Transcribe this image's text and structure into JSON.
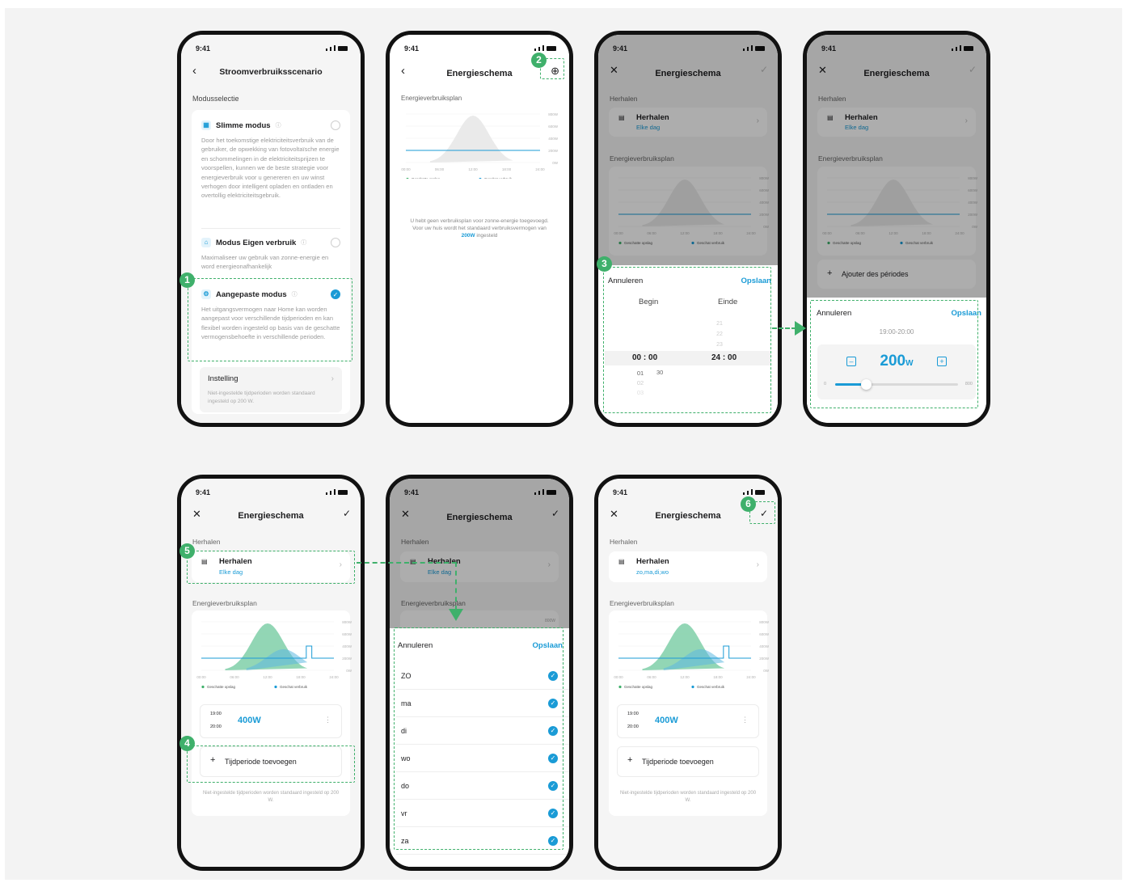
{
  "status_time": "9:41",
  "colors": {
    "accent": "#1a9bd6",
    "green": "#3fb06b",
    "chart_area": "#7fcfa8"
  },
  "chart": {
    "y_ticks": [
      "800W",
      "600W",
      "400W",
      "200W",
      "0W"
    ],
    "x_ticks": [
      "00:00",
      "06:00",
      "12:00",
      "18:00",
      "24:00"
    ],
    "legend_storage": "Geschatte opslag",
    "legend_consumption": "Geschat verbruik"
  },
  "s1": {
    "title": "Stroomverbruiksscenario",
    "section": "Modusselectie",
    "modes": [
      {
        "label": "Slimme modus",
        "icon": "smart-mode-icon",
        "desc": "Door het toekomstige elektriciteitsverbruik van de gebruiker, de opwekking van fotovoltaïsche energie en schommelingen in de elektriciteitsprijzen te voorspellen, kunnen we de beste strategie voor energieverbruik voor u genereren en uw winst verhogen door intelligent opladen en ontladen en overtollig elektriciteitsgebruik."
      },
      {
        "label": "Modus Eigen verbruik",
        "icon": "home-icon",
        "desc": "Maximaliseer uw gebruik van zonne-energie en word energieonafhankelijk"
      },
      {
        "label": "Aangepaste modus",
        "icon": "gear-icon",
        "desc": "Het uitgangsvermogen naar Home kan worden aangepast voor verschillende tijdperioden en kan flexibel worden ingesteld op basis van de geschatte vermogensbehoefte in verschillende perioden."
      }
    ],
    "setting_label": "Instelling",
    "setting_desc": "Niet-ingestelde tijdperioden worden standaard ingesteld op 200 W."
  },
  "s2": {
    "title": "Energieschema",
    "section": "Energieverbruiksplan",
    "empty_text": "U hebt geen verbruiksplan voor zonne-energie toegevoegd. Voor uw huis wordt het standaard verbruiksvermogen van",
    "empty_value": "200W",
    "empty_tail": "ingesteld"
  },
  "s3": {
    "title": "Energieschema",
    "repeat_section": "Herhalen",
    "repeat_label": "Herhalen",
    "repeat_value": "Elke dag",
    "plan_section": "Energieverbruiksplan",
    "cancel": "Annuleren",
    "save": "Opslaan",
    "begin": "Begin",
    "end": "Einde",
    "end_above": [
      "21",
      "22",
      "23"
    ],
    "sel_begin_h": "00",
    "sel_begin_m": "00",
    "sel_end_h": "24",
    "sel_end_m": "00",
    "below_h": [
      "01",
      "02",
      "03"
    ],
    "below_m": "30"
  },
  "s4": {
    "title": "Energieschema",
    "add_periods": "Ajouter des périodes",
    "cancel": "Annuleren",
    "save": "Opslaan",
    "range": "19:00-20:00",
    "value": "200",
    "unit": "W",
    "min": "0",
    "max": "800",
    "minus": "–",
    "plus": "+",
    "slider_fraction": 0.25
  },
  "s5": {
    "title": "Energieschema",
    "repeat_section": "Herhalen",
    "repeat_label": "Herhalen",
    "repeat_value": "Elke dag",
    "plan_section": "Energieverbruiksplan",
    "period_start": "19:00",
    "period_end": "20:00",
    "period_value": "400W",
    "add_period": "Tijdperiode toevoegen",
    "footer": "Niet-ingestelde tijdperioden worden standaard ingesteld op 200 W."
  },
  "s6": {
    "title": "Energieschema",
    "repeat_section": "Herhalen",
    "repeat_label": "Herhalen",
    "repeat_value": "Elke dag",
    "plan_section": "Energieverbruiksplan",
    "tick": "800W",
    "cancel": "Annuleren",
    "save": "Opslaan",
    "days": [
      "ZO",
      "ma",
      "di",
      "wo",
      "do",
      "vr",
      "za"
    ]
  },
  "s7": {
    "title": "Energieschema",
    "repeat_section": "Herhalen",
    "repeat_label": "Herhalen",
    "repeat_value": "zo,ma,di,wo",
    "plan_section": "Energieverbruiksplan",
    "period_start": "19:00",
    "period_end": "20:00",
    "period_value": "400W",
    "add_period": "Tijdperiode toevoegen",
    "footer": "Niet-ingestelde tijdperioden worden standaard ingesteld op 200 W."
  },
  "steps": [
    "1",
    "2",
    "3",
    "4",
    "5",
    "6"
  ]
}
